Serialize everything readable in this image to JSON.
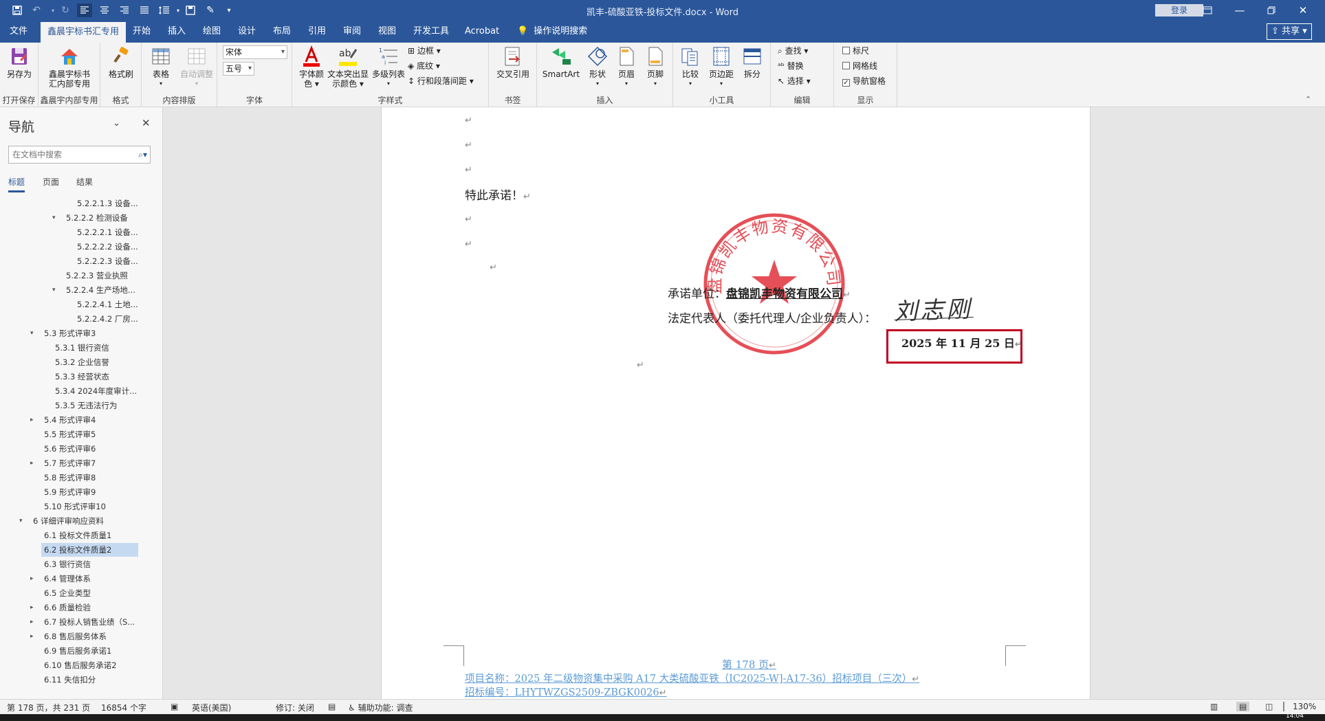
{
  "window": {
    "title": "凯丰-硫酸亚铁-投标文件.docx - Word",
    "login": "登录",
    "share": "共享"
  },
  "tabs": [
    "文件",
    "鑫晨宇标书汇专用",
    "开始",
    "插入",
    "绘图",
    "设计",
    "布局",
    "引用",
    "审阅",
    "视图",
    "开发工具",
    "Acrobat",
    "操作说明搜索"
  ],
  "ribbon": {
    "save_as": "另存为",
    "xcy_btn": [
      "鑫晨宇标书",
      "汇内部专用"
    ],
    "format_painter": "格式刷",
    "table": "表格",
    "auto_adjust": "自动调整",
    "font_name": "宋体",
    "font_size": "五号",
    "font_color": [
      "字体颜",
      "色"
    ],
    "highlight": [
      "文本突出显",
      "示颜色"
    ],
    "multilevel": "多级列表",
    "border": "边框",
    "shading": "底纹",
    "line_spacing": "行和段落间距",
    "cross_ref": "交叉引用",
    "smartart": "SmartArt",
    "shape": "形状",
    "header": "页眉",
    "footer": "页脚",
    "compare": "比较",
    "margins": "页边距",
    "split": "拆分",
    "find": "查找",
    "replace": "替换",
    "select": "选择",
    "ruler": "标尺",
    "gridlines": "网格线",
    "nav_pane": "导航窗格",
    "groups": {
      "open_save": "打开保存",
      "xcy_internal": "鑫晨宇内部专用",
      "format": "格式",
      "content_layout": "内容排版",
      "font": "字体",
      "char_style": "字样式",
      "bookmark": "书签",
      "insert": "插入",
      "small_tools": "小工具",
      "edit": "编辑",
      "show": "显示"
    }
  },
  "nav": {
    "title": "导航",
    "search_placeholder": "在文档中搜索",
    "tabs": [
      "标题",
      "页面",
      "结果"
    ],
    "items": [
      "5.2.2.1.3 设备...",
      "5.2.2.2 检测设备",
      "5.2.2.2.1 设备...",
      "5.2.2.2.2 设备...",
      "5.2.2.2.3 设备...",
      "5.2.2.3 营业执照",
      "5.2.2.4 生产场地...",
      "5.2.2.4.1 土地...",
      "5.2.2.4.2 厂房...",
      "5.3 形式评审3",
      "5.3.1 银行资信",
      "5.3.2 企业信誉",
      "5.3.3 经营状态",
      "5.3.4 2024年度审计...",
      "5.3.5 无违法行为",
      "5.4 形式评审4",
      "5.5 形式评审5",
      "5.6 形式评审6",
      "5.7 形式评审7",
      "5.8 形式评审8",
      "5.9 形式评审9",
      "5.10 形式评审10",
      "6 详细评审响应资料",
      "6.1 投标文件质量1",
      "6.2 投标文件质量2",
      "6.3 银行资信",
      "6.4 管理体系",
      "6.5 企业类型",
      "6.6 质量检验",
      "6.7 投标人销售业绩（S...",
      "6.8 售后服务体系",
      "6.9 售后服务承诺1",
      "6.10 售后服务承诺2",
      "6.11 失信扣分"
    ]
  },
  "document": {
    "pledge": "特此承诺！",
    "unit_label": "承诺单位：",
    "unit_name": "盘锦凯丰物资有限公司",
    "rep_label": "法定代表人（委托代理人/企业负责人）：",
    "signature": "刘志刚",
    "date": "2025 年 11 月 25 日",
    "seal_text": "盘锦凯丰物资有限公司",
    "page_number": "第 178 页",
    "footer_project": "项目名称：2025 年二级物资集中采购 A17 大类硫酸亚铁（IC2025-W]-A17-36）招标项目（三次）",
    "footer_code": "招标编号：LHYTWZGS2509-ZBGK0026",
    "para_mark": "↵"
  },
  "status": {
    "page": "第 178 页，共 231 页",
    "words": "16854 个字",
    "language": "英语(美国)",
    "track": "修订: 关闭",
    "accessibility": "辅助功能: 调查",
    "zoom": "130%",
    "time": "14:04"
  }
}
